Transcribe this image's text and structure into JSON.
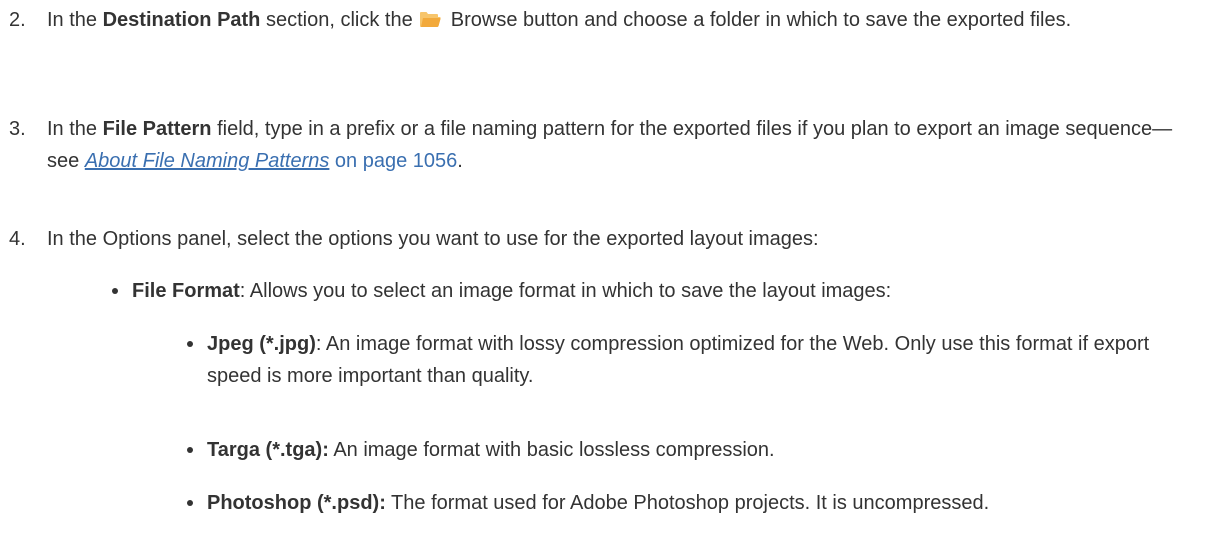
{
  "steps": [
    {
      "number": "2.",
      "pre": "In the ",
      "bold": "Destination Path",
      "mid": " section, click the ",
      "icon": "folder-icon",
      "post": " Browse button and choose a folder in which to save the exported files."
    },
    {
      "number": "3.",
      "pre": "In the ",
      "bold": "File Pattern",
      "mid": " field, type in a prefix or a file naming pattern for the exported files if you plan to export an image sequence—see ",
      "link_text": "About File Naming Patterns",
      "link_tail": " on page 1056",
      "end": "."
    },
    {
      "number": "4.",
      "text": "In the Options panel, select the options you want to use for the exported layout images:"
    }
  ],
  "options": {
    "file_format": {
      "bold": "File Format",
      "text": ": Allows you to select an image format in which to save the layout images:"
    },
    "formats": [
      {
        "bold": "Jpeg (*.jpg)",
        "text": ": An image format with lossy compression optimized for the Web. Only use this format if export speed is more important than quality."
      },
      {
        "bold": "Targa (*.tga):",
        "text": " An image format with basic lossless compression."
      },
      {
        "bold": "Photoshop (*.psd):",
        "text": " The format used for Adobe Photoshop projects. It is uncompressed."
      }
    ]
  },
  "colors": {
    "text": "#333333",
    "link": "#3a6fb0",
    "folder_icon": "#f2a93b"
  }
}
